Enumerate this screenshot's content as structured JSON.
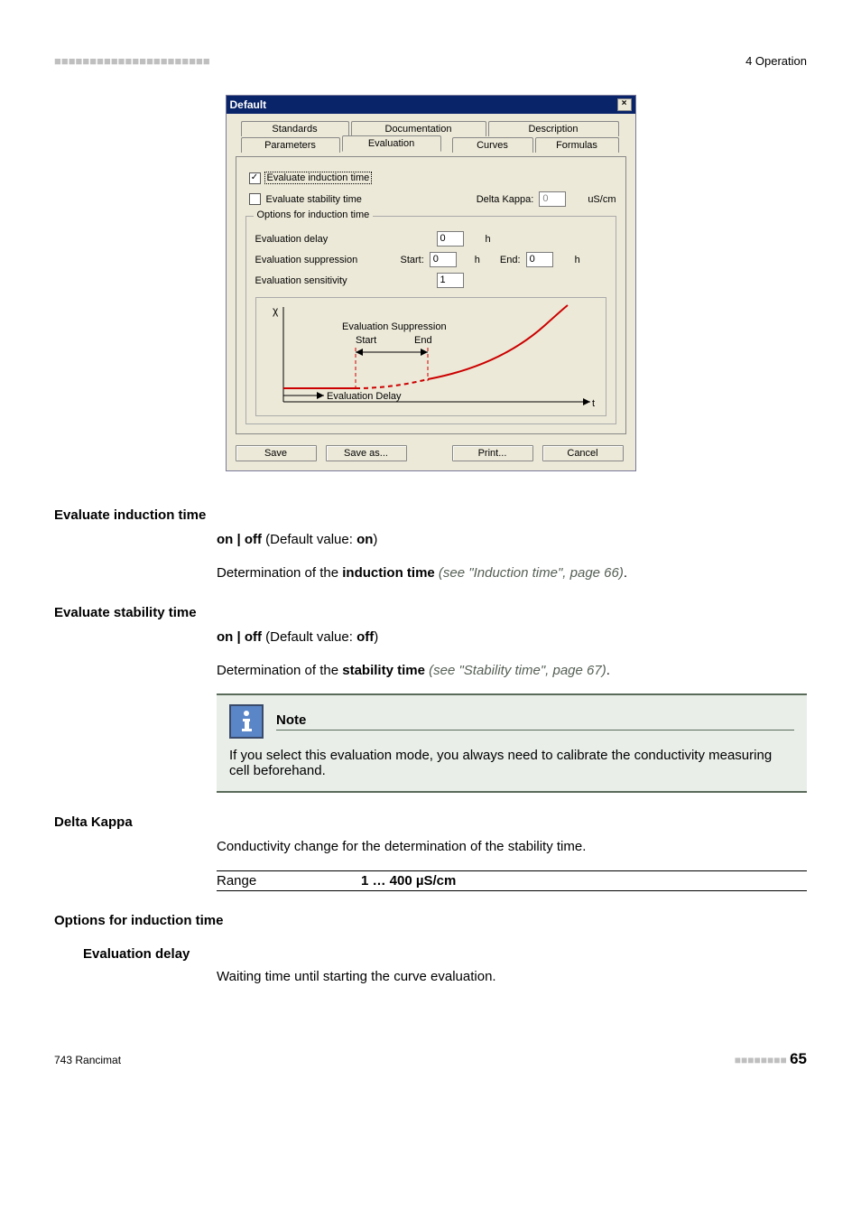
{
  "header": {
    "ticks": "■■■■■■■■■■■■■■■■■■■■■■",
    "section": "4 Operation"
  },
  "dialog": {
    "title": "Default",
    "tabs": {
      "standards": "Standards",
      "documentation": "Documentation",
      "description": "Description",
      "parameters": "Parameters",
      "evaluation": "Evaluation",
      "curves": "Curves",
      "formulas": "Formulas"
    },
    "cb_induction": "Evaluate induction time",
    "cb_stability": "Evaluate stability time",
    "delta_kappa_label": "Delta Kappa:",
    "delta_kappa_value": "0",
    "delta_kappa_unit": "uS/cm",
    "options_legend": "Options for induction time",
    "rows": {
      "eval_delay_label": "Evaluation delay",
      "eval_delay_value": "0",
      "eval_delay_unit": "h",
      "eval_supp_label": "Evaluation suppression",
      "supp_start_label": "Start:",
      "supp_start_value": "0",
      "supp_start_unit": "h",
      "supp_end_label": "End:",
      "supp_end_value": "0",
      "supp_end_unit": "h",
      "eval_sens_label": "Evaluation sensitivity",
      "eval_sens_value": "1"
    },
    "chart": {
      "y_axis": "χ",
      "x_axis": "t",
      "supp_label": "Evaluation Suppression",
      "supp_start": "Start",
      "supp_end": "End",
      "delay_label": "Evaluation Delay"
    },
    "buttons": {
      "save": "Save",
      "save_as": "Save as...",
      "print": "Print...",
      "cancel": "Cancel"
    }
  },
  "content": {
    "h_induction": "Evaluate induction time",
    "ind_onoff": "on | off",
    "ind_default_pre": " (Default value: ",
    "ind_default_val": "on",
    "ind_default_suf": ")",
    "ind_desc_pre": "Determination of the ",
    "ind_desc_bold": "induction time",
    "ind_desc_ital": " (see \"Induction time\", page 66)",
    "ind_desc_suf": ".",
    "h_stability": "Evaluate stability time",
    "stab_onoff": "on | off",
    "stab_default_pre": " (Default value: ",
    "stab_default_val": "off",
    "stab_default_suf": ")",
    "stab_desc_pre": "Determination of the ",
    "stab_desc_bold": "stability time",
    "stab_desc_ital": " (see \"Stability time\", page 67)",
    "stab_desc_suf": ".",
    "note_title": "Note",
    "note_body": "If you select this evaluation mode, you always need to calibrate the conductivity measuring cell beforehand.",
    "h_delta": "Delta Kappa",
    "delta_desc": "Conductivity change for the determination of the stability time.",
    "range_label": "Range",
    "range_value": "1 … 400 µS/cm",
    "h_options": "Options for induction time",
    "h_eval_delay": "Evaluation delay",
    "eval_delay_desc": "Waiting time until starting the curve evaluation."
  },
  "footer": {
    "left": "743 Rancimat",
    "dots": "■■■■■■■■",
    "page": "65"
  }
}
